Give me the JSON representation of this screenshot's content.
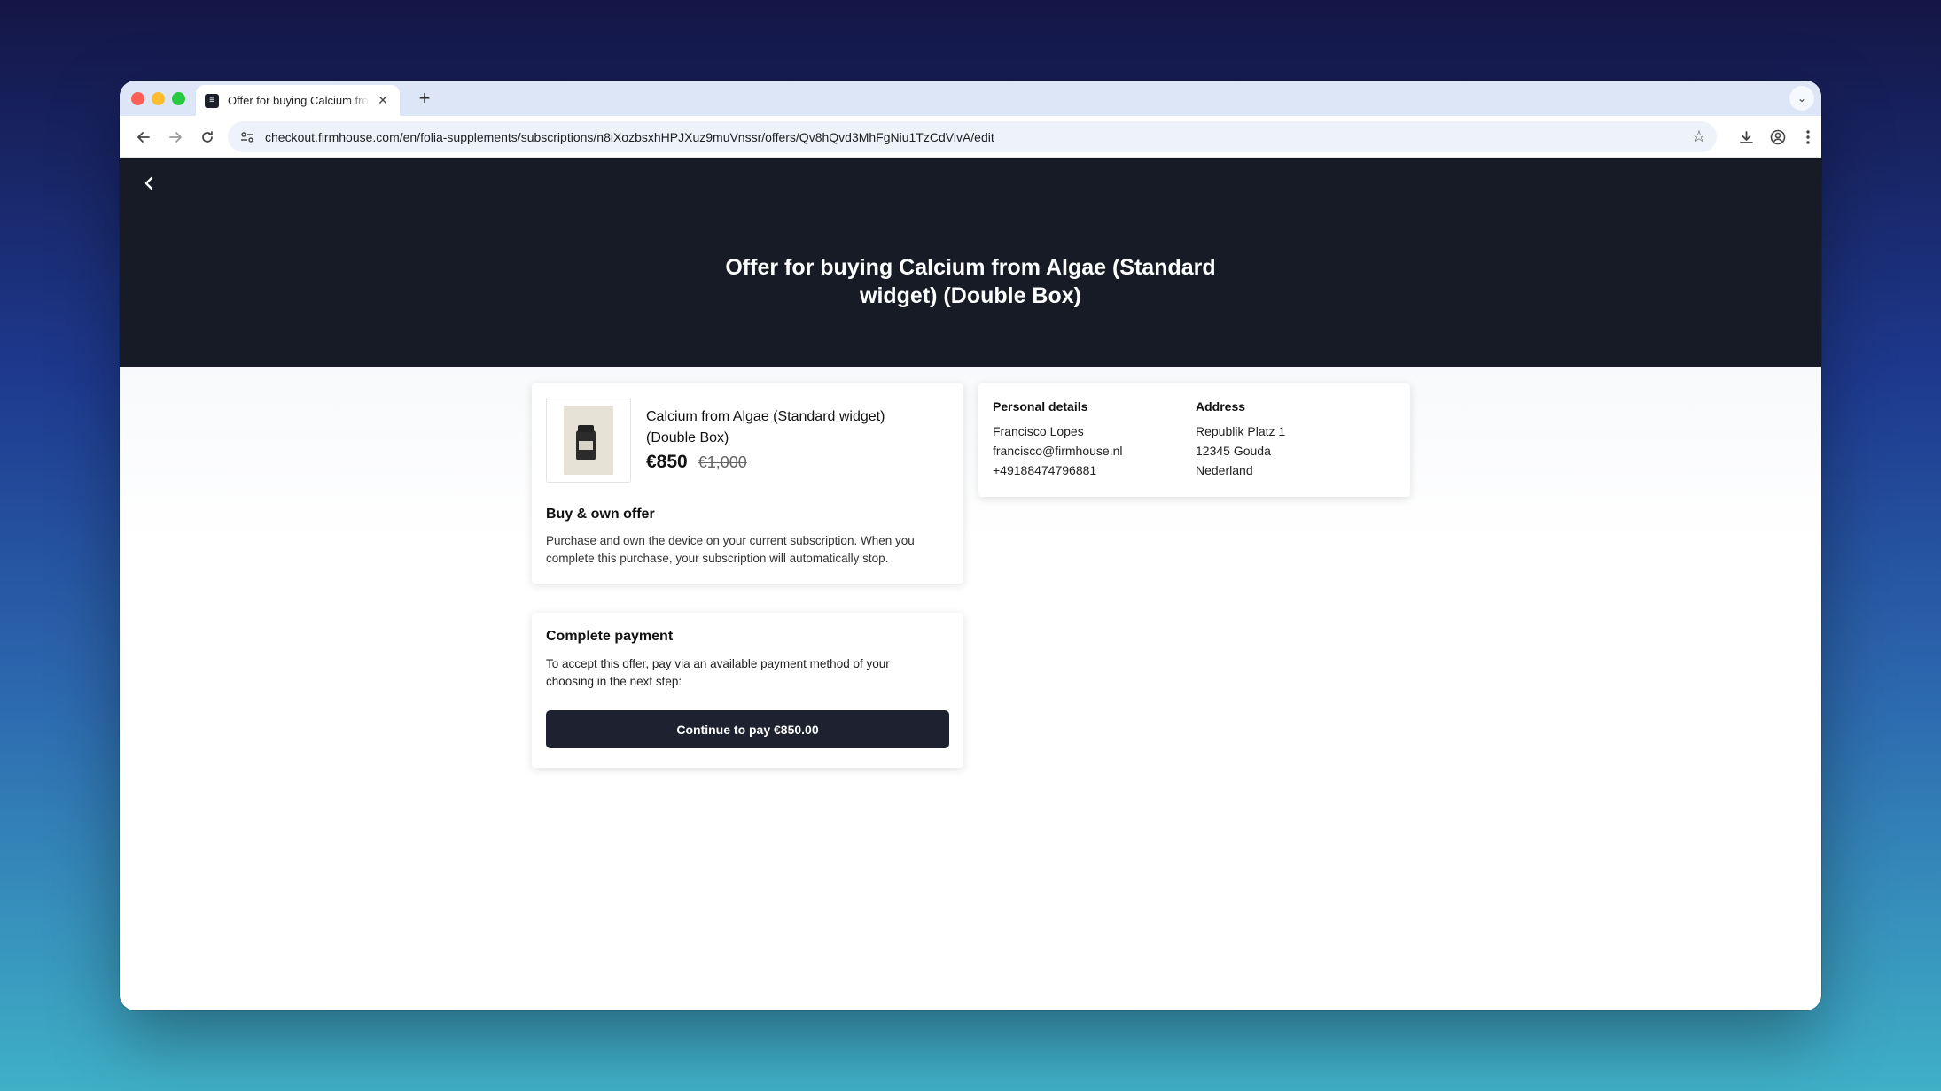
{
  "browser": {
    "tab_title": "Offer for buying Calcium from Algae (Standard widget) (Double Box)",
    "url": "checkout.firmhouse.com/en/folia-supplements/subscriptions/n8iXozbsxhHPJXuz9muVnssr/offers/Qv8hQvd3MhFgNiu1TzCdVivA/edit",
    "icons": {
      "back": "arrow-left-icon",
      "forward": "arrow-right-icon",
      "reload": "reload-icon",
      "site_info": "tune-icon",
      "bookmark": "star-icon",
      "download": "download-icon",
      "profile": "profile-icon",
      "menu": "kebab-menu-icon"
    }
  },
  "header": {
    "title": "Offer for buying Calcium from Algae (Standard widget) (Double Box)"
  },
  "product": {
    "name": "Calcium from Algae (Standard widget) (Double Box)",
    "price": "€850",
    "old_price": "€1,000"
  },
  "offer": {
    "title": "Buy & own offer",
    "description": "Purchase and own the device on your current subscription. When you complete this purchase, your subscription will automatically stop."
  },
  "personal_details": {
    "heading": "Personal details",
    "name": "Francisco Lopes",
    "email": "francisco@firmhouse.nl",
    "phone": "+49188474796881"
  },
  "address": {
    "heading": "Address",
    "street": "Republik Platz 1",
    "city": "12345 Gouda",
    "country": "Nederland"
  },
  "payment": {
    "title": "Complete payment",
    "description": "To accept this offer, pay via an available payment method of your choosing in the next step:",
    "button_label": "Continue to pay €850.00"
  },
  "colors": {
    "hero_bg": "#161b26",
    "button_bg": "#1d2130"
  }
}
